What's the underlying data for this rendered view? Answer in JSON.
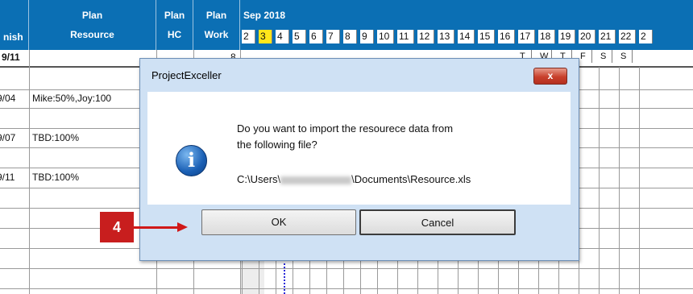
{
  "spreadsheet": {
    "headers": {
      "finish": "nish",
      "plan_resource": [
        "Plan",
        "Resource"
      ],
      "plan_hc": [
        "Plan",
        "HC"
      ],
      "plan_work": [
        "Plan",
        "Work"
      ],
      "month": "Sep 2018"
    },
    "finish_top": "9/11",
    "work_top": "8",
    "days": [
      "2",
      "3",
      "4",
      "5",
      "6",
      "7",
      "8",
      "9",
      "10",
      "11",
      "12",
      "13",
      "14",
      "15",
      "16",
      "17",
      "18",
      "19",
      "20",
      "21",
      "22",
      "2"
    ],
    "highlight_day": "3",
    "weekdays_visible": [
      "T",
      "W",
      "T",
      "F",
      "S",
      "S"
    ],
    "rows": [
      {
        "finish": "9/04",
        "resource": "Mike:50%,Joy:100"
      },
      {
        "finish": "9/07",
        "resource": "TBD:100%"
      },
      {
        "finish": "9/11",
        "resource": "TBD:100%"
      }
    ]
  },
  "dialog": {
    "title": "ProjectExceller",
    "close_label": "x",
    "message_line1": "Do you want to import the resourece data from",
    "message_line2": "the following file?",
    "path_prefix": "C:\\Users\\",
    "path_suffix": "\\Documents\\Resource.xls",
    "ok_label": "OK",
    "cancel_label": "Cancel",
    "icon": "info-icon"
  },
  "annotation": {
    "step": "4",
    "color": "#c81e1e"
  },
  "colors": {
    "header_bg": "#0b6fb4",
    "highlight": "#ffe61a",
    "dialog_bg": "#cfe1f4"
  }
}
